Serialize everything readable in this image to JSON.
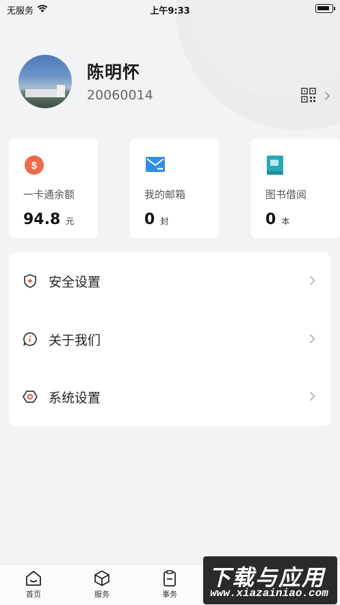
{
  "status_bar": {
    "carrier": "无服务",
    "time": "上午9:33"
  },
  "profile": {
    "name": "陈明怀",
    "id": "20060014"
  },
  "stats": [
    {
      "label": "一卡通余额",
      "value": "94.8",
      "unit": "元",
      "icon": "dollar-coin-icon",
      "color": "#ee6a4a"
    },
    {
      "label": "我的邮箱",
      "value": "0",
      "unit": "封",
      "icon": "mail-icon",
      "color": "#2f8ee8"
    },
    {
      "label": "图书借阅",
      "value": "0",
      "unit": "本",
      "icon": "book-icon",
      "color": "#2aa7b8"
    }
  ],
  "menu": [
    {
      "label": "安全设置",
      "icon": "shield-plus-icon"
    },
    {
      "label": "关于我们",
      "icon": "info-bubble-icon"
    },
    {
      "label": "系统设置",
      "icon": "hexagon-settings-icon"
    }
  ],
  "tabbar": [
    {
      "label": "首页",
      "icon": "home-icon"
    },
    {
      "label": "服务",
      "icon": "cube-icon"
    },
    {
      "label": "事务",
      "icon": "clipboard-icon"
    }
  ],
  "watermark": {
    "line1": "下载与应用",
    "line2": "www.xiazainiao.com"
  },
  "colors": {
    "accent_red": "#e0473a",
    "background": "#f2f3f5"
  }
}
